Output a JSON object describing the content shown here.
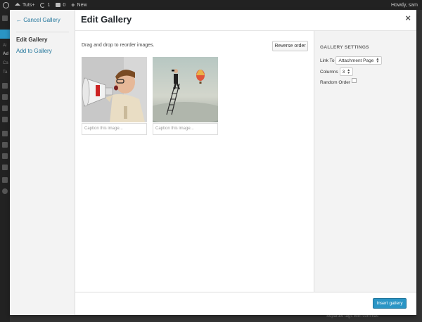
{
  "adminbar": {
    "site_name": "Tuts+",
    "updates_count": "1",
    "comments_count": "0",
    "new_label": "New",
    "howdy": "Howdy, sam"
  },
  "background": {
    "menu_fragments": [
      "Al",
      "Ad",
      "Ca",
      "Ta"
    ],
    "bottom_text": "Separate tags with commas"
  },
  "modal": {
    "title": "Edit Gallery",
    "close_label": "×",
    "sidebar": {
      "cancel_label": "← Cancel Gallery",
      "edit_label": "Edit Gallery",
      "add_label": "Add to Gallery"
    },
    "content": {
      "hint": "Drag and drop to reorder images.",
      "reverse_label": "Reverse order",
      "images": [
        {
          "alt": "Boy shouting into megaphone",
          "caption_placeholder": "Caption this image..."
        },
        {
          "alt": "Man on ladder with binoculars and hot air balloon",
          "caption_placeholder": "Caption this image..."
        }
      ]
    },
    "settings": {
      "heading": "GALLERY SETTINGS",
      "link_to_label": "Link To",
      "link_to_value": "Attachment Page",
      "columns_label": "Columns",
      "columns_value": "3",
      "random_label": "Random Order"
    },
    "footer": {
      "insert_label": "Insert gallery"
    }
  },
  "colors": {
    "accent": "#2a95c5",
    "link": "#21759b",
    "adminbar": "#222222"
  }
}
